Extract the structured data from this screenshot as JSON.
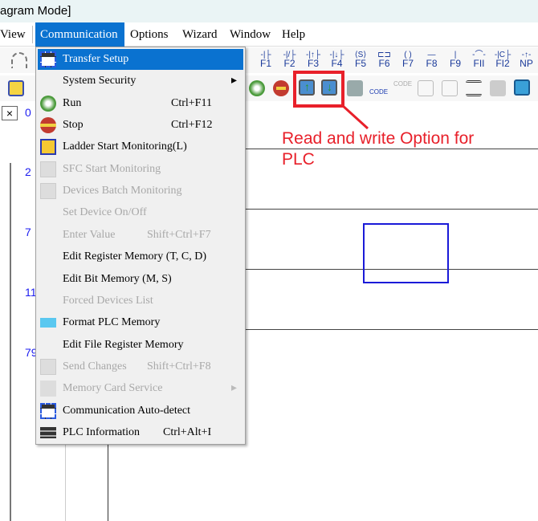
{
  "window": {
    "title": "agram Mode]"
  },
  "menubar": {
    "items": [
      "View",
      "Communication",
      "Options",
      "Wizard",
      "Window",
      "Help"
    ]
  },
  "toolbar": {
    "fkeys": [
      "F1",
      "F2",
      "F3",
      "F4",
      "F5",
      "F6",
      "F7",
      "F8",
      "F9",
      "FII",
      "FI2",
      "NP"
    ],
    "fkey_symbols": [
      "-|├",
      "-|/├",
      "-|↑├",
      "-|↓├",
      "⟨S⟩",
      "⊏⊐",
      "( )",
      "—",
      "|",
      "-⌒-",
      "-|C├",
      "-↑-"
    ]
  },
  "ladder": {
    "line_numbers": [
      "0",
      "2",
      "7",
      "11",
      "79"
    ]
  },
  "communication_menu": {
    "items": [
      {
        "label": "Transfer Setup",
        "shortcut": "",
        "enabled": true,
        "icon": "transfer-setup-icon"
      },
      {
        "label": "System Security",
        "shortcut": "",
        "enabled": true,
        "submenu": true
      },
      {
        "label": "Run",
        "shortcut": "Ctrl+F11",
        "enabled": true,
        "icon": "run-icon"
      },
      {
        "label": "Stop",
        "shortcut": "Ctrl+F12",
        "enabled": true,
        "icon": "stop-icon"
      },
      {
        "label": "Ladder Start Monitoring(L)",
        "shortcut": "",
        "enabled": true,
        "icon": "ladder-monitor-icon"
      },
      {
        "label": "SFC Start Monitoring",
        "shortcut": "",
        "enabled": false,
        "icon": "sfc-monitor-icon"
      },
      {
        "label": "Devices Batch Monitoring",
        "shortcut": "",
        "enabled": false,
        "icon": "batch-monitor-icon"
      },
      {
        "label": "Set Device On/Off",
        "shortcut": "",
        "enabled": false
      },
      {
        "label": "Enter Value",
        "shortcut": "Shift+Ctrl+F7",
        "enabled": false
      },
      {
        "label": "Edit Register Memory (T, C, D)",
        "shortcut": "",
        "enabled": true
      },
      {
        "label": "Edit Bit Memory (M, S)",
        "shortcut": "",
        "enabled": true
      },
      {
        "label": "Forced Devices List",
        "shortcut": "",
        "enabled": false
      },
      {
        "label": "Format PLC Memory",
        "shortcut": "",
        "enabled": true,
        "icon": "format-memory-icon"
      },
      {
        "label": "Edit File Register Memory",
        "shortcut": "",
        "enabled": true
      },
      {
        "label": "Send Changes",
        "shortcut": "Shift+Ctrl+F8",
        "enabled": false,
        "icon": "send-changes-icon"
      },
      {
        "label": "Memory Card Service",
        "shortcut": "",
        "enabled": false,
        "submenu": true,
        "icon": "memory-card-icon"
      },
      {
        "label": "Communication Auto-detect",
        "shortcut": "",
        "enabled": true,
        "icon": "auto-detect-icon"
      },
      {
        "label": "PLC Information",
        "shortcut": "Ctrl+Alt+I",
        "enabled": true,
        "icon": "plc-info-icon"
      }
    ]
  },
  "annotation": {
    "line1": "Read and write Option for",
    "line2": "PLC",
    "color": "#e8202a"
  },
  "colors": {
    "accent": "#0a72d0",
    "highlight_box": "#e8202a",
    "ladder_box": "#1a1ad8"
  }
}
